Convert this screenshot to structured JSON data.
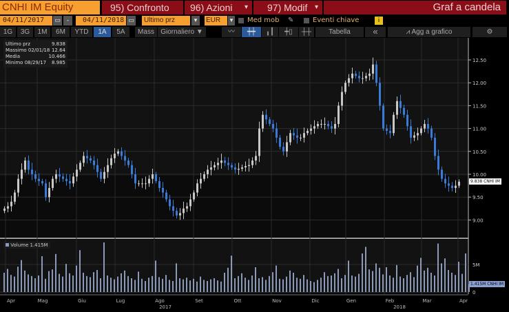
{
  "header": {
    "ticker": "CNHI IM Equity",
    "compare": "95) Confronto",
    "actions": "96) Azioni",
    "edit": "97) Modif",
    "title": "Graf a candela",
    "dropdown_arrow": "▾"
  },
  "controls": {
    "start_date": "04/11/2017",
    "end_date": "04/11/2018",
    "date_sep": "-",
    "field": "Ultimo prz",
    "currency": "EUR",
    "moving_avg": "Med mob",
    "key_events": "Eventi chiave",
    "info": "i"
  },
  "toolbar": {
    "periods": [
      "1G",
      "3G",
      "1M",
      "6M",
      "YTD",
      "1A",
      "5A",
      "Mass"
    ],
    "active_period": "1A",
    "frequency": "Giornaliero ▼",
    "table": "Tabella",
    "collapse": "«",
    "add_to_chart": "Agg a grafico",
    "settings": "⚙"
  },
  "legend": [
    {
      "label": "Ultimo prz",
      "value": "9.838"
    },
    {
      "label": "Massimo 02/01/18",
      "value": "12.64"
    },
    {
      "label": "Media",
      "value": "10.466"
    },
    {
      "label": "Minimo 08/29/17",
      "value": "8.985"
    }
  ],
  "volume_legend": "Volume 1.415M",
  "last_price_tag": "9.838 CNHI IM",
  "last_volume_tag": "1.415M CNHI IM",
  "colors": {
    "up": "#c8c8c8",
    "down": "#3b7bd8",
    "volume": "#8a9ab8",
    "accent": "#f7a030",
    "red": "#8b0d18"
  },
  "chart_data": {
    "type": "candlestick",
    "title": "CNHI IM Equity",
    "y_ticks": [
      "9.00",
      "9.50",
      "10.00",
      "10.50",
      "11.00",
      "11.50",
      "12.00",
      "12.50"
    ],
    "ylim": [
      8.8,
      12.75
    ],
    "volume_ticks": [
      "0",
      "5M"
    ],
    "volume_ylim": [
      0,
      10
    ],
    "x_months": [
      "Apr",
      "Mag",
      "Giu",
      "Lug",
      "Ago",
      "Set",
      "Ott",
      "Nov",
      "Dic",
      "Gen",
      "Feb",
      "Mar",
      "Apr"
    ],
    "x_years": [
      "2017",
      "2018"
    ],
    "closes": [
      9.25,
      9.3,
      9.4,
      9.6,
      9.9,
      10.1,
      10.3,
      10.1,
      10.0,
      9.9,
      9.85,
      9.8,
      9.5,
      9.7,
      9.9,
      10.0,
      9.95,
      9.9,
      9.85,
      9.8,
      9.95,
      10.1,
      10.25,
      10.4,
      10.35,
      10.3,
      10.2,
      10.05,
      9.9,
      10.05,
      10.2,
      10.35,
      10.45,
      10.5,
      10.4,
      10.3,
      10.2,
      10.0,
      9.8,
      9.8,
      9.8,
      9.8,
      9.9,
      10.0,
      9.85,
      9.7,
      9.6,
      9.45,
      9.3,
      9.2,
      9.1,
      9.15,
      9.25,
      9.3,
      9.45,
      9.6,
      9.8,
      9.9,
      10.0,
      10.1,
      10.15,
      10.2,
      10.25,
      10.3,
      10.25,
      10.2,
      10.15,
      10.1,
      10.12,
      10.15,
      10.18,
      10.2,
      10.3,
      10.4,
      11.0,
      11.3,
      11.2,
      11.1,
      11.0,
      10.8,
      10.6,
      10.5,
      10.7,
      10.9,
      10.85,
      10.8,
      10.8,
      10.9,
      10.95,
      11.0,
      11.05,
      11.1,
      11.1,
      11.1,
      11.05,
      11.0,
      11.1,
      11.5,
      11.8,
      12.0,
      12.1,
      12.2,
      12.15,
      12.1,
      12.1,
      12.15,
      12.2,
      12.4,
      12.0,
      11.5,
      11.0,
      10.95,
      10.9,
      11.3,
      11.6,
      11.45,
      11.3,
      11.05,
      10.8,
      10.85,
      10.9,
      11.0,
      11.1,
      11.0,
      10.8,
      10.4,
      10.1,
      9.9,
      9.8,
      9.75,
      9.7,
      9.75,
      9.838
    ],
    "volumes_m": [
      3.5,
      4.2,
      3.1,
      2.8,
      4.6,
      5.8,
      3.9,
      3.2,
      2.9,
      2.5,
      3.0,
      6.5,
      2.4,
      3.8,
      4.1,
      6.9,
      3.3,
      2.8,
      5.1,
      3.4,
      3.0,
      4.8,
      7.6,
      3.5,
      2.9,
      2.7,
      3.6,
      4.0,
      2.5,
      9.0,
      3.0,
      2.6,
      2.3,
      2.8,
      3.4,
      3.9,
      2.9,
      2.5,
      2.2,
      3.7,
      2.4,
      2.0,
      2.6,
      2.9,
      5.7,
      2.7,
      2.4,
      3.1,
      2.2,
      2.0,
      5.2,
      2.5,
      2.3,
      2.6,
      2.1,
      2.4,
      1.9,
      2.8,
      2.2,
      2.0,
      2.3,
      2.5,
      2.1,
      1.9,
      3.5,
      4.4,
      6.6,
      2.5,
      2.9,
      3.4,
      2.6,
      2.2,
      3.0,
      4.5,
      2.5,
      2.7,
      2.2,
      2.9,
      3.6,
      4.8,
      2.4,
      2.3,
      2.8,
      3.9,
      3.5,
      2.6,
      2.4,
      3.1,
      2.3,
      2.0,
      1.8,
      2.2,
      2.6,
      3.6,
      2.9,
      3.0,
      3.4,
      4.2,
      2.5,
      3.1,
      5.7,
      3.0,
      2.8,
      3.3,
      7.0,
      8.2,
      4.1,
      3.8,
      5.2,
      4.4,
      3.2,
      4.5,
      3.0,
      2.6,
      4.9,
      2.8,
      2.5,
      3.1,
      3.6,
      2.7,
      4.8,
      6.2,
      3.9,
      4.4,
      3.5,
      3.0,
      8.8,
      5.2,
      6.1,
      4.0,
      3.5,
      3.1,
      5.5,
      3.3,
      7.0,
      1.4
    ]
  }
}
